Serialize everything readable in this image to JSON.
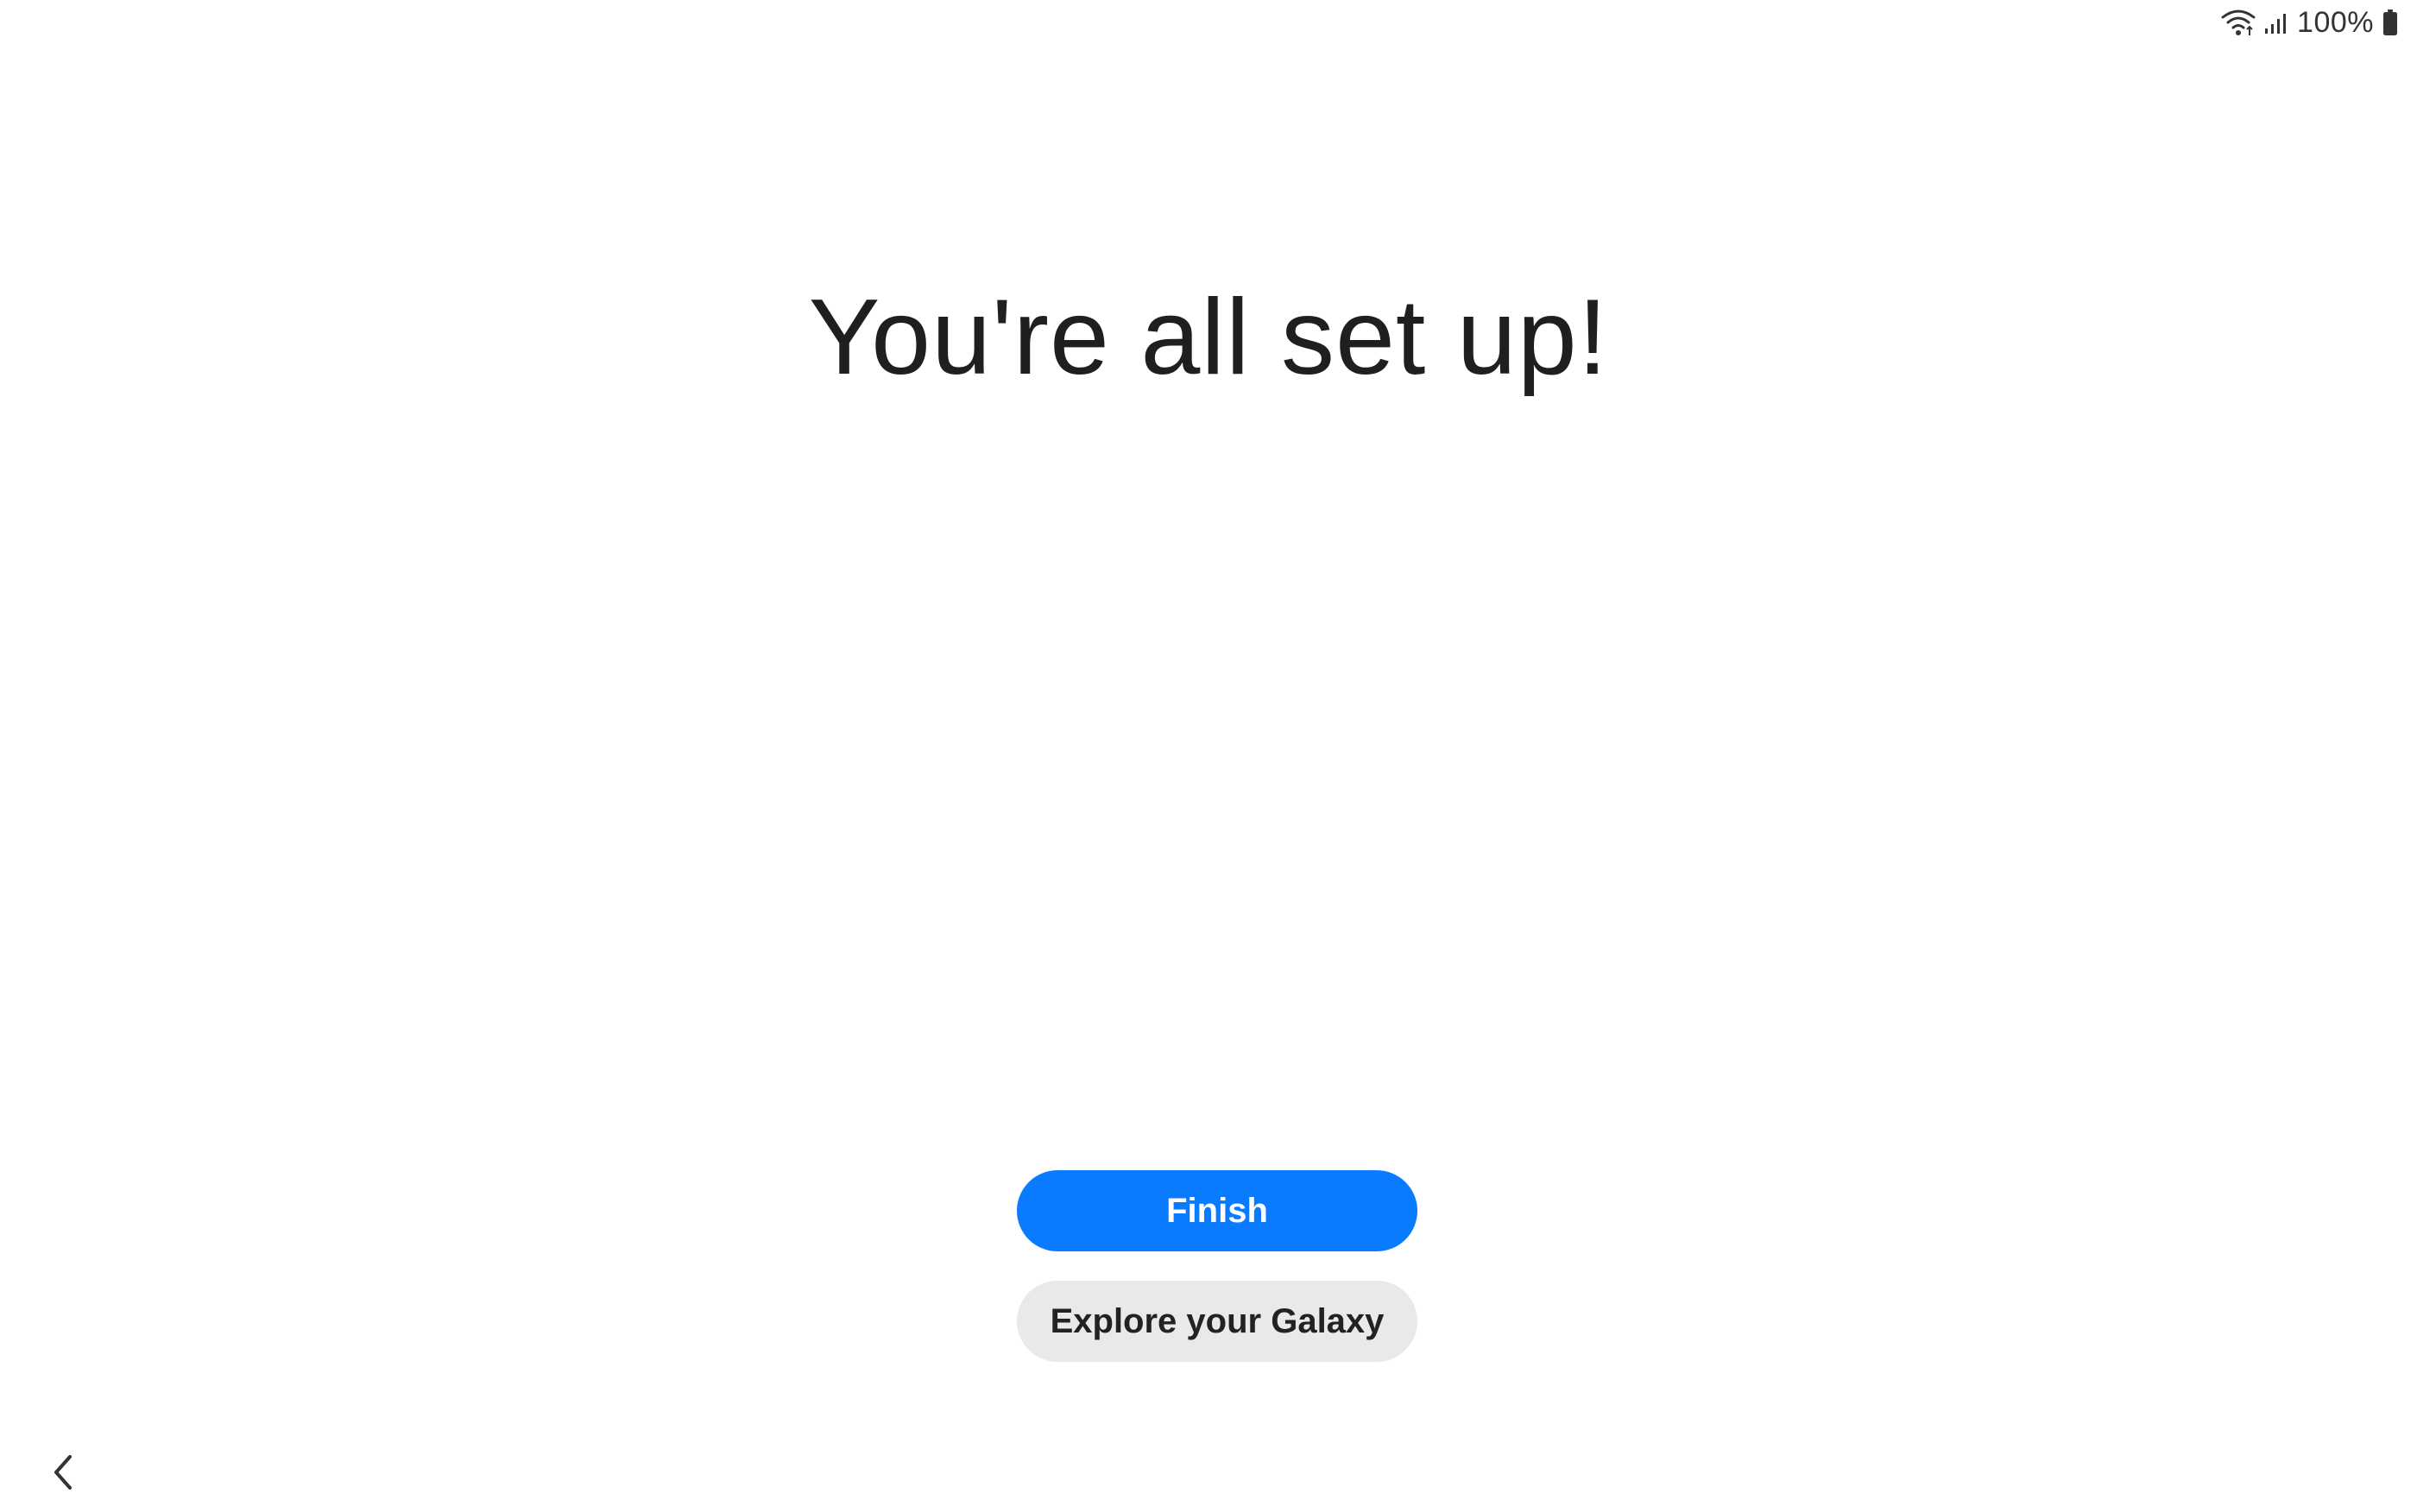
{
  "status_bar": {
    "wifi_icon": "wifi-icon",
    "signal_icon": "cellular-signal-icon",
    "battery_text": "100%",
    "battery_icon": "battery-icon"
  },
  "main": {
    "title": "You're all set up!"
  },
  "actions": {
    "finish_label": "Finish",
    "explore_label": "Explore your Galaxy"
  },
  "navigation": {
    "back_icon": "chevron-left-icon"
  },
  "colors": {
    "primary": "#0a7bff",
    "secondary_button": "#e9e9e9",
    "background": "#ffffff",
    "text": "#222222"
  }
}
